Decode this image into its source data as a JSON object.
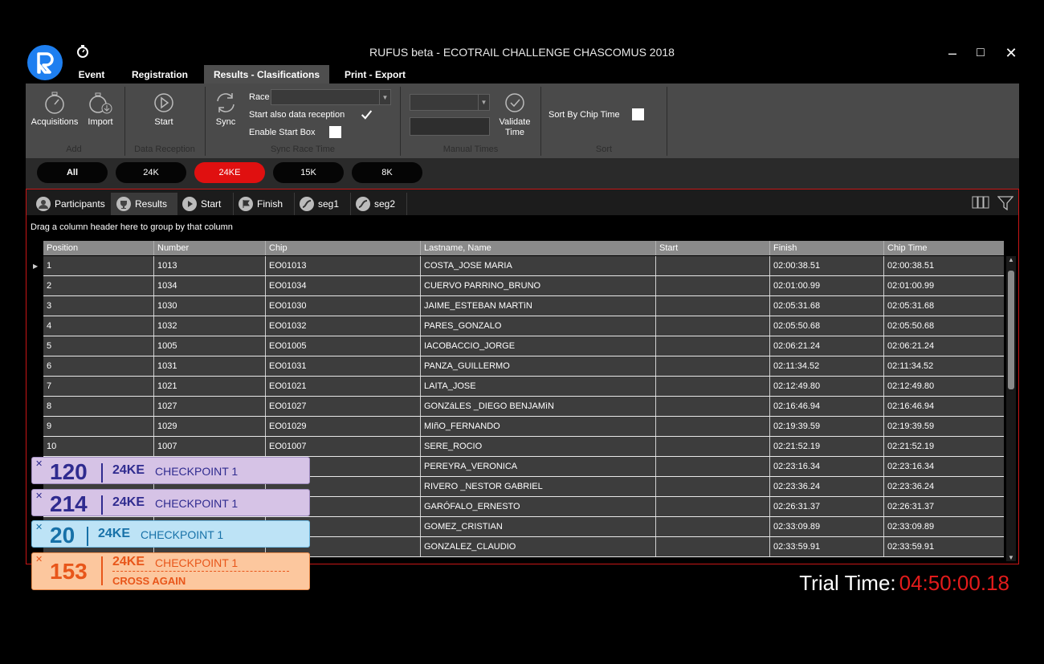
{
  "window": {
    "title": "RUFUS beta - ECOTRAIL CHALLENGE CHASCOMUS 2018",
    "controls": {
      "minimize": "–",
      "maximize": "□",
      "close": "✕"
    }
  },
  "menu": {
    "tabs": [
      {
        "label": "Event",
        "active": false
      },
      {
        "label": "Registration",
        "active": false
      },
      {
        "label": "Results - Clasifications",
        "active": true
      },
      {
        "label": "Print - Export",
        "active": false
      }
    ]
  },
  "ribbon": {
    "add": {
      "acquisitions_label": "Acquisitions",
      "import_label": "Import",
      "group_label": "Add"
    },
    "data_reception": {
      "start_label": "Start",
      "group_label": "Data Reception"
    },
    "sync": {
      "sync_label": "Sync",
      "race_label": "Race",
      "race_value": "",
      "start_also_label": "Start also data reception",
      "start_also_checked": true,
      "enable_start_box_label": "Enable Start Box",
      "enable_start_box_checked": false,
      "group_label": "Sync Race Time"
    },
    "manual_times": {
      "combo_value": "",
      "time_value": "",
      "validate_label_1": "Validate",
      "validate_label_2": "Time",
      "group_label": "Manual Times"
    },
    "sort": {
      "sort_by_chip_label": "Sort By Chip Time",
      "sort_by_chip_checked": false,
      "group_label": "Sort"
    }
  },
  "race_filters": [
    {
      "label": "All",
      "active": false
    },
    {
      "label": "24K",
      "active": false
    },
    {
      "label": "24KE",
      "active": true
    },
    {
      "label": "15K",
      "active": false
    },
    {
      "label": "8K",
      "active": false
    }
  ],
  "subtabs": [
    {
      "label": "Participants",
      "icon": "person-icon",
      "active": false
    },
    {
      "label": "Results",
      "icon": "trophy-icon",
      "active": true
    },
    {
      "label": "Start",
      "icon": "play-icon",
      "active": false
    },
    {
      "label": "Finish",
      "icon": "flag-icon",
      "active": false
    },
    {
      "label": "seg1",
      "icon": "segment-icon",
      "active": false
    },
    {
      "label": "seg2",
      "icon": "segment-icon",
      "active": false
    }
  ],
  "grid": {
    "group_hint": "Drag a column header here to group by that column",
    "columns": [
      "Position",
      "Number",
      "Chip",
      "Lastname, Name",
      "Start",
      "Finish",
      "Chip Time"
    ],
    "rows": [
      [
        "1",
        "1013",
        "EO01013",
        "COSTA_JOSE MARIA",
        "",
        "02:00:38.51",
        "02:00:38.51"
      ],
      [
        "2",
        "1034",
        "EO01034",
        "CUERVO PARRINO_BRUNO",
        "",
        "02:01:00.99",
        "02:01:00.99"
      ],
      [
        "3",
        "1030",
        "EO01030",
        "JAIME_ESTEBAN MARTìN",
        "",
        "02:05:31.68",
        "02:05:31.68"
      ],
      [
        "4",
        "1032",
        "EO01032",
        "PARES_GONZALO",
        "",
        "02:05:50.68",
        "02:05:50.68"
      ],
      [
        "5",
        "1005",
        "EO01005",
        "IACOBACCIO_JORGE",
        "",
        "02:06:21.24",
        "02:06:21.24"
      ],
      [
        "6",
        "1031",
        "EO01031",
        "PANZA_GUILLERMO",
        "",
        "02:11:34.52",
        "02:11:34.52"
      ],
      [
        "7",
        "1021",
        "EO01021",
        "LAITA_JOSE",
        "",
        "02:12:49.80",
        "02:12:49.80"
      ],
      [
        "8",
        "1027",
        "EO01027",
        "GONZáLES _DIEGO BENJAMìN",
        "",
        "02:16:46.94",
        "02:16:46.94"
      ],
      [
        "9",
        "1029",
        "EO01029",
        "MIñO_FERNANDO",
        "",
        "02:19:39.59",
        "02:19:39.59"
      ],
      [
        "10",
        "1007",
        "EO01007",
        "SERE_ROCIO",
        "",
        "02:21:52.19",
        "02:21:52.19"
      ],
      [
        "",
        "",
        "",
        "PEREYRA_VERONICA",
        "",
        "02:23:16.34",
        "02:23:16.34"
      ],
      [
        "",
        "",
        "",
        "RIVERO _NESTOR GABRIEL",
        "",
        "02:23:36.24",
        "02:23:36.24"
      ],
      [
        "",
        "",
        "",
        "GARÓFALO_ERNESTO",
        "",
        "02:26:31.37",
        "02:26:31.37"
      ],
      [
        "",
        "",
        "",
        "GOMEZ_CRISTIAN",
        "",
        "02:33:09.89",
        "02:33:09.89"
      ],
      [
        "",
        "",
        "",
        "GONZALEZ_CLAUDIO",
        "",
        "02:33:59.91",
        "02:33:59.91"
      ]
    ]
  },
  "notifications": [
    {
      "number": "120",
      "race": "24KE",
      "checkpoint": "CHECKPOINT 1",
      "extra": "",
      "bg": "#d6c3e6",
      "border": "#a08cc0",
      "fg": "#2f2b8f"
    },
    {
      "number": "214",
      "race": "24KE",
      "checkpoint": "CHECKPOINT 1",
      "extra": "",
      "bg": "#d6c3e6",
      "border": "#a08cc0",
      "fg": "#2f2b8f"
    },
    {
      "number": "20",
      "race": "24KE",
      "checkpoint": "CHECKPOINT 1",
      "extra": "",
      "bg": "#bde3f6",
      "border": "#6fb8e0",
      "fg": "#1771a8"
    },
    {
      "number": "153",
      "race": "24KE",
      "checkpoint": "CHECKPOINT 1",
      "extra": "CROSS AGAIN",
      "bg": "#fcc79e",
      "border": "#e88a4a",
      "fg": "#e8561a"
    }
  ],
  "trial_time": {
    "label": "Trial Time:",
    "value": "04:50:00.18"
  }
}
